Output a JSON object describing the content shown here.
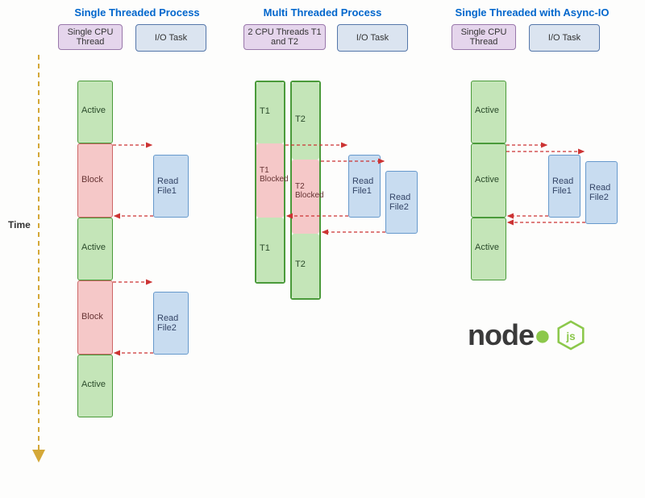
{
  "titles": {
    "col1": "Single Threaded Process",
    "col2": "Multi Threaded Process",
    "col3": "Single Threaded with Async-IO"
  },
  "headers": {
    "col1_cpu": "Single CPU Thread",
    "col1_io": "I/O Task",
    "col2_cpu": "2 CPU Threads T1 and T2",
    "col2_io": "I/O Task",
    "col3_cpu": "Single CPU Thread",
    "col3_io": "I/O Task"
  },
  "labels": {
    "active": "Active",
    "block": "Block",
    "read_file1": "Read File1",
    "read_file2": "Read File2",
    "t1": "T1",
    "t2": "T2",
    "t1_blocked": "T1 Blocked",
    "t2_blocked": "T2 Blocked",
    "time": "Time"
  },
  "logo": {
    "text": "node",
    "suffix": "js"
  },
  "chart_data": {
    "type": "timeline-diagram",
    "columns": [
      {
        "name": "Single Threaded Process",
        "thread": [
          {
            "state": "Active",
            "from": 0,
            "to": 1
          },
          {
            "state": "Block",
            "from": 1,
            "to": 2,
            "io": "Read File1"
          },
          {
            "state": "Active",
            "from": 2,
            "to": 3
          },
          {
            "state": "Block",
            "from": 3,
            "to": 4,
            "io": "Read File2"
          },
          {
            "state": "Active",
            "from": 4,
            "to": 5
          }
        ]
      },
      {
        "name": "Multi Threaded Process",
        "threads": [
          {
            "id": "T1",
            "segments": [
              {
                "state": "Active",
                "from": 0,
                "to": 1
              },
              {
                "state": "Blocked",
                "from": 1,
                "to": 2,
                "io": "Read File1"
              },
              {
                "state": "Active",
                "from": 2,
                "to": 3
              }
            ]
          },
          {
            "id": "T2",
            "segments": [
              {
                "state": "Active",
                "from": 0,
                "to": 1.3
              },
              {
                "state": "Blocked",
                "from": 1.3,
                "to": 2.3,
                "io": "Read File2"
              },
              {
                "state": "Active",
                "from": 2.3,
                "to": 3.3
              }
            ]
          }
        ]
      },
      {
        "name": "Single Threaded with Async-IO",
        "thread": [
          {
            "state": "Active",
            "from": 0,
            "to": 1,
            "dispatch": [
              "Read File1",
              "Read File2"
            ]
          },
          {
            "state": "Active",
            "from": 1,
            "to": 2
          },
          {
            "state": "Active",
            "from": 2,
            "to": 3
          }
        ]
      }
    ],
    "time_axis": "vertical-down"
  }
}
